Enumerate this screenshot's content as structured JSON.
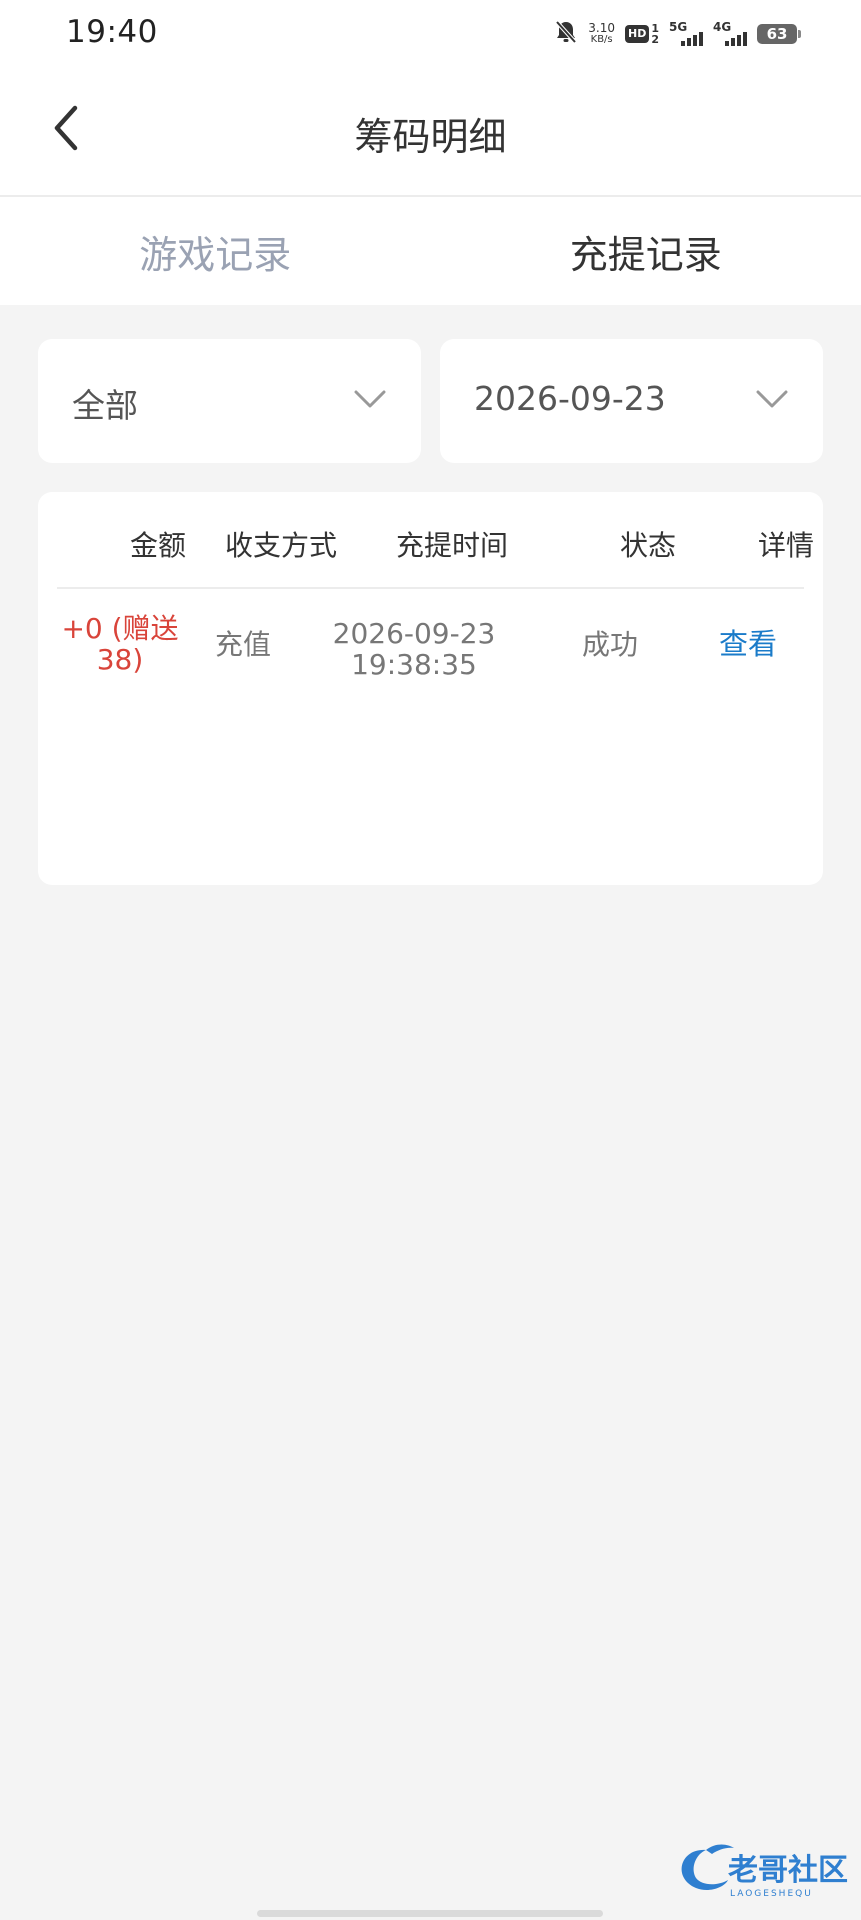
{
  "status_bar": {
    "time": "19:40",
    "net_speed_value": "3.10",
    "net_speed_unit": "KB/s",
    "hd_label": "HD",
    "hd_sup": "1",
    "hd_sub": "2",
    "signal_1_label": "5G",
    "signal_2_label": "4G",
    "battery_level": "63",
    "icons": [
      "bell-muted-icon",
      "hd-icon",
      "signal-5g-icon",
      "signal-4g-icon",
      "battery-icon"
    ]
  },
  "navbar": {
    "title": "筹码明细",
    "back_icon": "chevron-left-icon"
  },
  "tabs": [
    {
      "label": "游戏记录",
      "active": false
    },
    {
      "label": "充提记录",
      "active": true
    }
  ],
  "filters": {
    "type": {
      "value": "全部",
      "icon": "chevron-down-icon"
    },
    "date": {
      "value": "2026-09-23",
      "icon": "chevron-down-icon"
    }
  },
  "table": {
    "headers": [
      "金额",
      "收支方式",
      "充提时间",
      "状态",
      "详情"
    ],
    "rows": [
      {
        "amount_line1": "+0 (赠送",
        "amount_line2": "38)",
        "method": "充值",
        "date": "2026-09-23",
        "time": "19:38:35",
        "status": "成功",
        "detail": "查看"
      }
    ]
  },
  "colors": {
    "accent_link": "#1a7bc9",
    "amount_red": "#d9443a",
    "tab_inactive": "#9aa2b3",
    "page_bg": "#f4f4f4"
  },
  "watermark": {
    "text": "老哥社区",
    "subtext": "LAOGESHEQU"
  }
}
